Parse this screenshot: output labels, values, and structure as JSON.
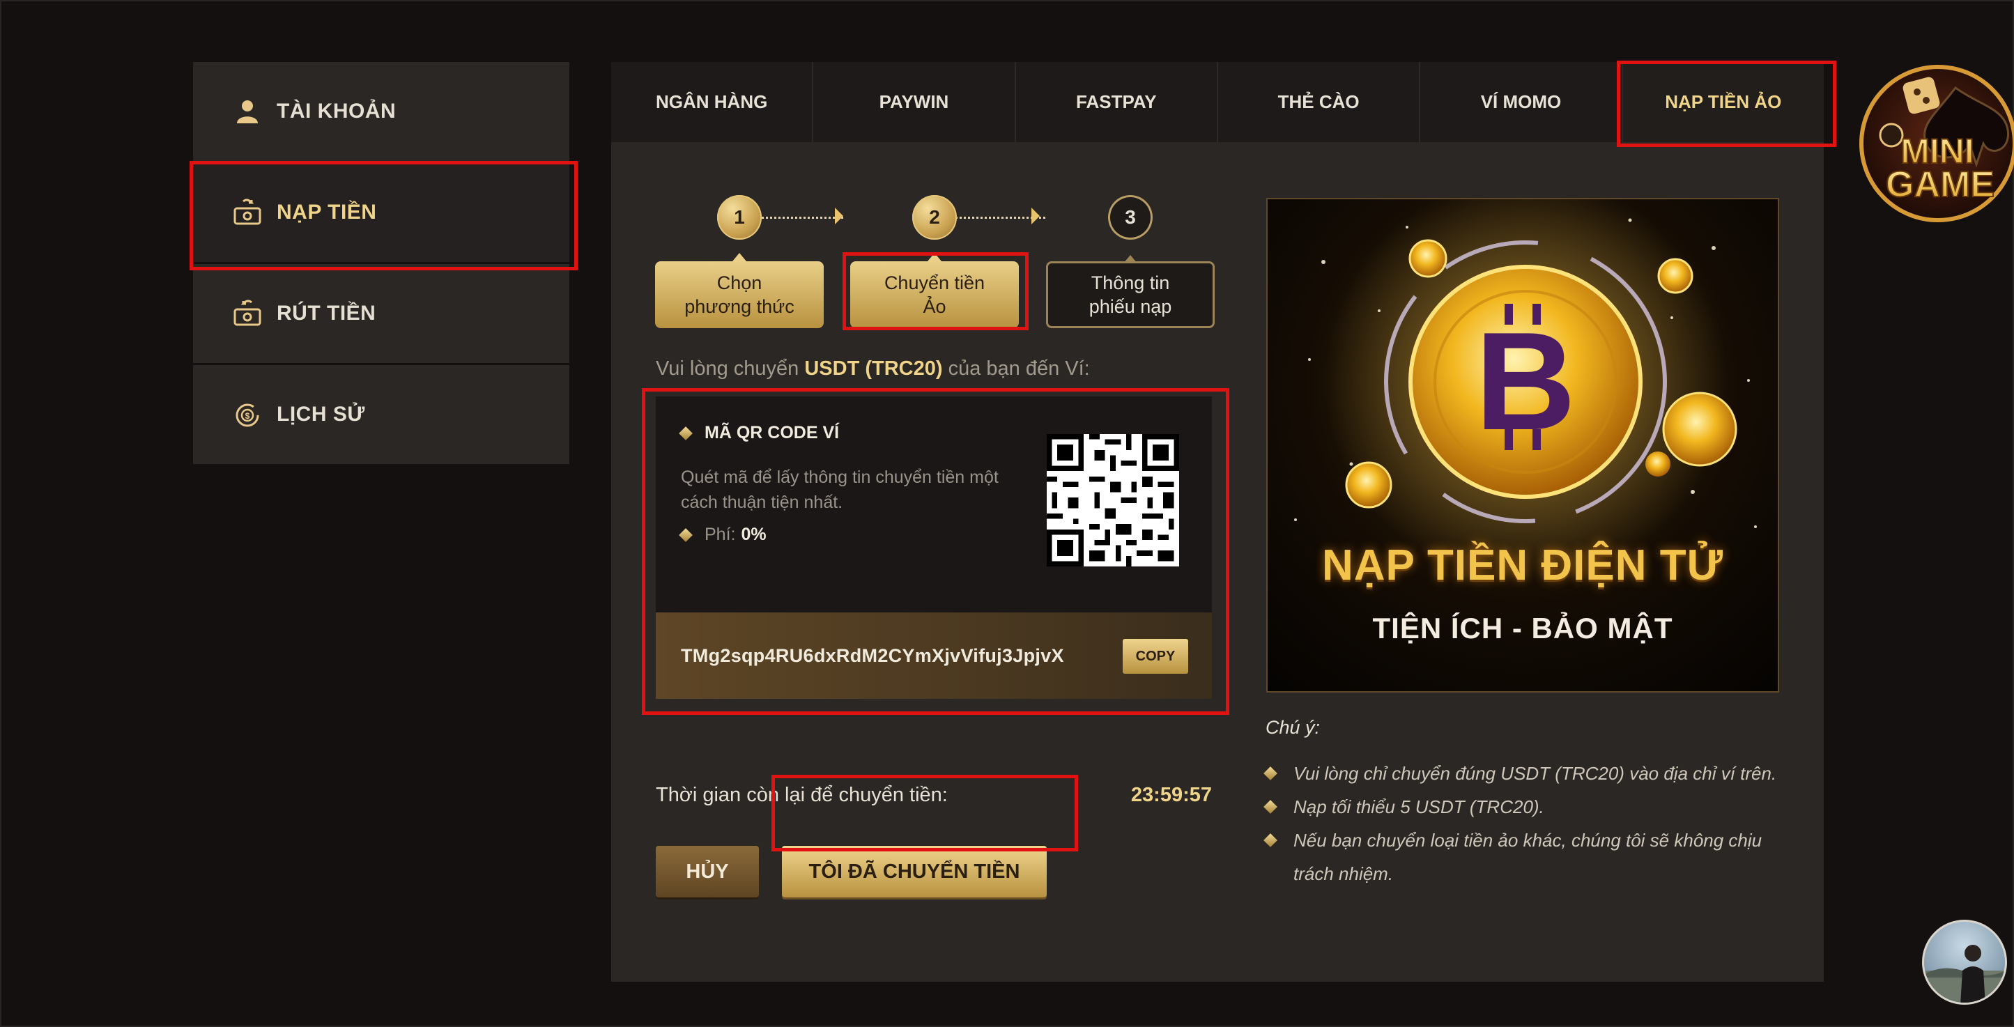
{
  "sidebar": {
    "items": [
      {
        "label": "TÀI KHOẢN",
        "icon": "user-icon"
      },
      {
        "label": "NẠP TIỀN",
        "icon": "deposit-money-icon",
        "active": true
      },
      {
        "label": "RÚT TIỀN",
        "icon": "withdraw-money-icon"
      },
      {
        "label": "LỊCH SỬ",
        "icon": "history-icon"
      }
    ]
  },
  "tabs": [
    {
      "label": "NGÂN HÀNG"
    },
    {
      "label": "PAYWIN"
    },
    {
      "label": "FASTPAY"
    },
    {
      "label": "THẺ CÀO"
    },
    {
      "label": "VÍ MOMO"
    },
    {
      "label": "NẠP TIỀN ẢO",
      "active": true
    }
  ],
  "steps": [
    {
      "number": "1",
      "line1": "Chọn",
      "line2": "phương thức",
      "state": "done"
    },
    {
      "number": "2",
      "line1": "Chuyển tiền",
      "line2": "Ảo",
      "state": "current"
    },
    {
      "number": "3",
      "line1": "Thông tin",
      "line2": "phiếu nạp",
      "state": "todo"
    }
  ],
  "instruction": {
    "prefix": "Vui lòng chuyển ",
    "currency": "USDT (TRC20)",
    "suffix": " của bạn đến Ví:"
  },
  "wallet": {
    "qr_title": "MÃ QR CODE VÍ",
    "qr_desc": "Quét mã để lấy thông tin chuyển tiền một cách thuận tiện nhất.",
    "fee_label": "Phí:",
    "fee_value": "0%",
    "address": "TMg2sqp4RU6dxRdM2CYmXjvVifuj3JpjvX",
    "copy_label": "COPY"
  },
  "timer": {
    "label": "Thời gian còn lại để chuyển tiền:",
    "value": "23:59:57"
  },
  "buttons": {
    "cancel": "HỦY",
    "confirm": "TÔI ĐÃ CHUYỂN TIỀN"
  },
  "banner": {
    "line1": "NẠP TIỀN ĐIỆN TỬ",
    "line2": "TIỆN ÍCH - BẢO MẬT"
  },
  "notes": {
    "heading": "Chú ý:",
    "items": [
      "Vui lòng chỉ chuyển đúng USDT (TRC20) vào địa chỉ ví trên.",
      "Nạp tối thiểu 5 USDT (TRC20).",
      "Nếu bạn chuyển loại tiền ảo khác, chúng tôi sẽ không chịu trách nhiệm."
    ]
  },
  "minigame": {
    "line1": "MINI",
    "line2": "GAME"
  },
  "colors": {
    "accent_gold": "#f0d489",
    "highlight_red": "#e01212",
    "panel_bg": "#2b2724",
    "page_bg": "#141010"
  }
}
